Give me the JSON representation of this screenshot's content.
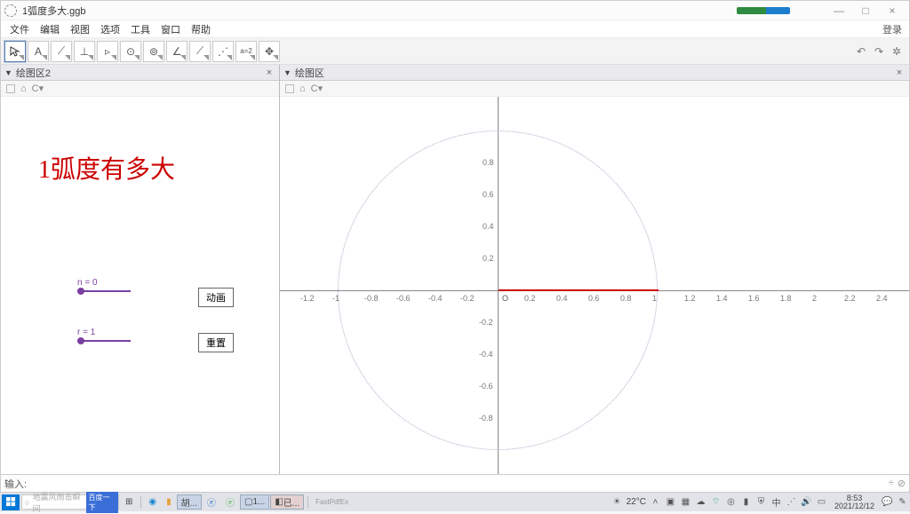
{
  "window": {
    "title": "1弧度多大.ggb",
    "minimize": "—",
    "maximize": "□",
    "close": "×"
  },
  "menu": {
    "file": "文件",
    "edit": "编辑",
    "view": "视图",
    "options": "选项",
    "tools": "工具",
    "window": "窗口",
    "help": "帮助",
    "login": "登录"
  },
  "toolbar_icons": [
    "▸",
    "A",
    "•",
    "⟋",
    "⊥",
    "▹",
    "⊙",
    "⊚",
    "∠",
    "⟋",
    "⋰",
    "a=2",
    "✥"
  ],
  "pane_left": {
    "title": "绘图区2",
    "close": "×"
  },
  "pane_right": {
    "title": "绘图区",
    "close": "×"
  },
  "left": {
    "big_title": "1弧度有多大",
    "slider1_label": "n = 0",
    "slider2_label": "r = 1",
    "btn_anim": "动画",
    "btn_reset": "重置"
  },
  "graph": {
    "origin": "O",
    "x_ticks": [
      "-1.2",
      "-1",
      "-0.8",
      "-0.6",
      "-0.4",
      "-0.2",
      "0.2",
      "0.4",
      "0.6",
      "0.8",
      "1",
      "1.2",
      "1.4",
      "1.6",
      "1.8",
      "2",
      "2.2",
      "2.4"
    ],
    "y_ticks_pos": [
      "0.2",
      "0.4",
      "0.6",
      "0.8"
    ],
    "y_ticks_neg": [
      "-0.2",
      "-0.4",
      "-0.6",
      "-0.8"
    ]
  },
  "input": {
    "label": "输入:",
    "help": "⊘"
  },
  "taskbar": {
    "search_placeholder": "地震风雨击瞬间",
    "search_btn": "百度一下",
    "items": [
      "胡...",
      "1...",
      "已..."
    ],
    "temp": "22°C",
    "time": "8:53",
    "date": "2021/12/12"
  },
  "chart_data": {
    "type": "scatter",
    "title": "1弧度有多大",
    "series": [
      {
        "name": "unit-circle",
        "shape": "circle",
        "cx": 0,
        "cy": 0,
        "r": 1
      },
      {
        "name": "radius",
        "shape": "line",
        "x1": 0,
        "y1": 0,
        "x2": 1,
        "y2": 0
      }
    ],
    "xlim": [
      -1.3,
      2.45
    ],
    "ylim": [
      -1,
      1
    ],
    "params": {
      "n": 0,
      "r": 1
    }
  }
}
